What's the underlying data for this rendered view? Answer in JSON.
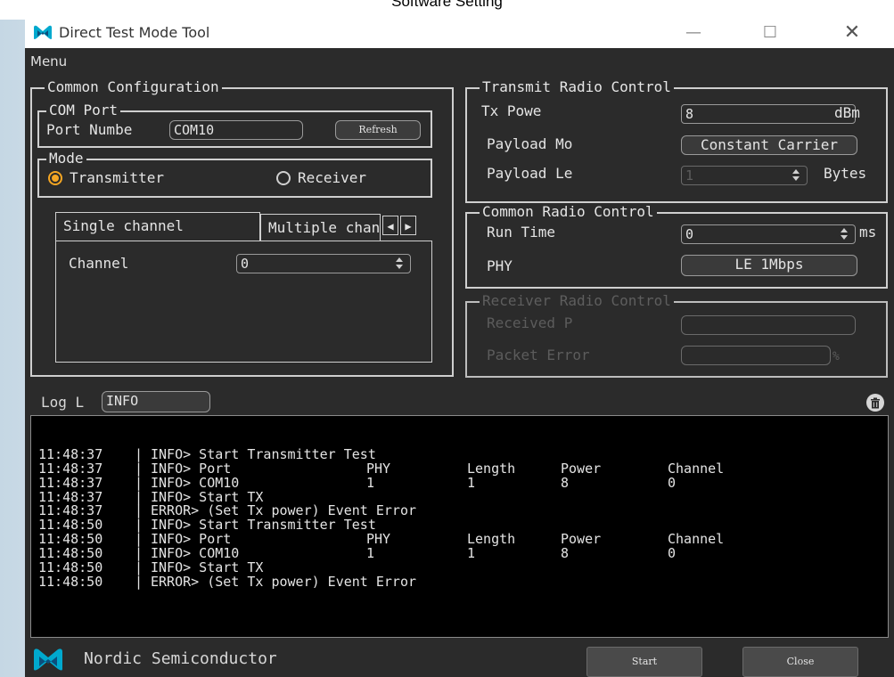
{
  "caption": "Software Setting",
  "window": {
    "title": "Direct Test Mode Tool",
    "minimize": "—",
    "maximize": "☐",
    "close": "✕"
  },
  "menu": {
    "label": "Menu"
  },
  "common_config": {
    "title": "Common Configuration",
    "com_port": {
      "title": "COM Port",
      "port_label": "Port Numbe",
      "port_value": "COM10",
      "refresh_label": "Refresh"
    },
    "mode": {
      "title": "Mode",
      "transmitter_label": "Transmitter",
      "receiver_label": "Receiver",
      "selected": "transmitter"
    },
    "tabs": [
      {
        "label": "Single channel"
      },
      {
        "label": "Multiple channels"
      }
    ],
    "channel": {
      "label": "Channel",
      "value": "0"
    }
  },
  "transmit": {
    "title": "Transmit Radio Control",
    "tx_power_label": "Tx Powe",
    "tx_power_value": "8",
    "tx_power_unit": "dBm",
    "payload_mode_label": "Payload Mo",
    "payload_mode_value": "Constant Carrier",
    "payload_length_label": "Payload Le",
    "payload_length_value": "1",
    "payload_length_unit": "Bytes"
  },
  "common_radio": {
    "title": "Common Radio Control",
    "run_time_label": "Run Time",
    "run_time_value": "0",
    "run_time_unit": "ms",
    "phy_label": "PHY",
    "phy_value": "LE 1Mbps"
  },
  "receiver": {
    "title": "Receiver Radio Control",
    "received_label": "Received P",
    "packet_error_label": "Packet Error",
    "packet_error_unit": "%"
  },
  "log": {
    "level_label": "Log L",
    "level_value": "INFO",
    "rows": [
      {
        "time": "11:48:37",
        "sep": "|",
        "msg": "INFO> Start Transmitter Test",
        "phy": "",
        "len": "",
        "pow": "",
        "ch": ""
      },
      {
        "time": "11:48:37",
        "sep": "|",
        "msg": "INFO> Port",
        "phy": "PHY",
        "len": "Length",
        "pow": "Power",
        "ch": "Channel"
      },
      {
        "time": "11:48:37",
        "sep": "|",
        "msg": "INFO> COM10",
        "phy": "1",
        "len": "1",
        "pow": "8",
        "ch": "0"
      },
      {
        "time": "11:48:37",
        "sep": "|",
        "msg": "INFO> Start TX",
        "phy": "",
        "len": "",
        "pow": "",
        "ch": ""
      },
      {
        "time": "11:48:37",
        "sep": "|",
        "msg": "ERROR> (Set Tx power) Event Error",
        "phy": "",
        "len": "",
        "pow": "",
        "ch": ""
      },
      {
        "time": "11:48:50",
        "sep": "|",
        "msg": "INFO> Start Transmitter Test",
        "phy": "",
        "len": "",
        "pow": "",
        "ch": ""
      },
      {
        "time": "11:48:50",
        "sep": "|",
        "msg": "INFO> Port",
        "phy": "PHY",
        "len": "Length",
        "pow": "Power",
        "ch": "Channel"
      },
      {
        "time": "11:48:50",
        "sep": "|",
        "msg": "INFO> COM10",
        "phy": "1",
        "len": "1",
        "pow": "8",
        "ch": "0"
      },
      {
        "time": "11:48:50",
        "sep": "|",
        "msg": "INFO> Start TX",
        "phy": "",
        "len": "",
        "pow": "",
        "ch": ""
      },
      {
        "time": "11:48:50",
        "sep": "|",
        "msg": "ERROR> (Set Tx power) Event Error",
        "phy": "",
        "len": "",
        "pow": "",
        "ch": ""
      }
    ]
  },
  "footer": {
    "company": "Nordic Semiconductor",
    "start_label": "Start",
    "close_label": "Close"
  },
  "icons": {
    "app": "nordic-logo-icon",
    "trash": "trash-icon",
    "tab_left": "◀",
    "tab_right": "▶"
  },
  "colors": {
    "accent_radio": "#f5a623",
    "nordic_blue": "#00a9ce",
    "window_bg": "#2b2b2b"
  }
}
